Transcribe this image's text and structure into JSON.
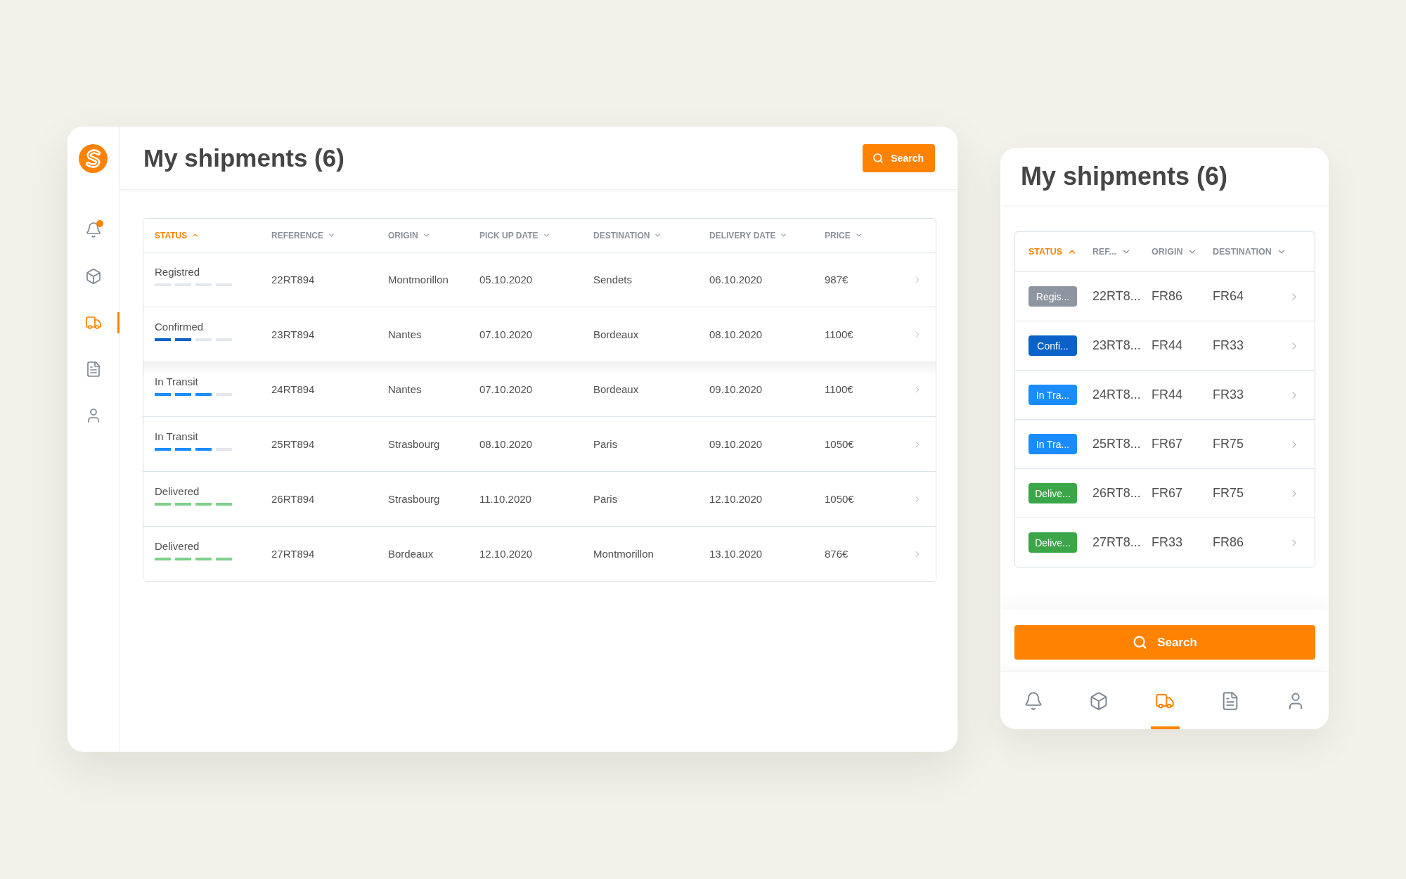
{
  "desktop": {
    "sidebar": {
      "items": [
        {
          "kind": "bell",
          "selected": false,
          "dot": true
        },
        {
          "kind": "box",
          "selected": false,
          "dot": false
        },
        {
          "kind": "truck",
          "selected": true,
          "dot": false
        },
        {
          "kind": "document",
          "selected": false,
          "dot": false
        },
        {
          "kind": "user",
          "selected": false,
          "dot": false
        }
      ]
    },
    "title": "My shipments (6)",
    "search_button": "Search",
    "table": {
      "columns": [
        {
          "label": "STATUS",
          "sorted": true
        },
        {
          "label": "REFERENCE",
          "sorted": false
        },
        {
          "label": "ORIGIN",
          "sorted": false
        },
        {
          "label": "PICK UP DATE",
          "sorted": false
        },
        {
          "label": "DESTINATION",
          "sorted": false
        },
        {
          "label": "DELIVERY DATE",
          "sorted": false
        },
        {
          "label": "PRICE",
          "sorted": false
        }
      ],
      "rows": [
        {
          "status": "Registred",
          "level": 0,
          "reference": "22RT894",
          "origin": "Montmorillon",
          "pick_up_date": "05.10.2020",
          "destination": "Sendets",
          "delivery_date": "06.10.2020",
          "price": "987€",
          "hovered": false
        },
        {
          "status": "Confirmed",
          "level": 0.5,
          "color": "#0a62c9",
          "reference": "23RT894",
          "origin": "Nantes",
          "pick_up_date": "07.10.2020",
          "destination": "Bordeaux",
          "delivery_date": "08.10.2020",
          "price": "1100€",
          "hovered": true
        },
        {
          "status": "In Transit",
          "level": 0.75,
          "color": "#1a8cff",
          "reference": "24RT894",
          "origin": "Nantes",
          "pick_up_date": "07.10.2020",
          "destination": "Bordeaux",
          "delivery_date": "09.10.2020",
          "price": "1100€",
          "hovered": false
        },
        {
          "status": "In Transit",
          "level": 0.75,
          "color": "#1a8cff",
          "reference": "25RT894",
          "origin": "Strasbourg",
          "pick_up_date": "08.10.2020",
          "destination": "Paris",
          "delivery_date": "09.10.2020",
          "price": "1050€",
          "hovered": false
        },
        {
          "status": "Delivered",
          "level": 1,
          "color": "#7dd08a",
          "reference": "26RT894",
          "origin": "Strasbourg",
          "pick_up_date": "11.10.2020",
          "destination": "Paris",
          "delivery_date": "12.10.2020",
          "price": "1050€",
          "hovered": false
        },
        {
          "status": "Delivered",
          "level": 1,
          "color": "#7dd08a",
          "reference": "27RT894",
          "origin": "Bordeaux",
          "pick_up_date": "12.10.2020",
          "destination": "Montmorillon",
          "delivery_date": "13.10.2020",
          "price": "876€",
          "hovered": false
        }
      ]
    }
  },
  "mobile": {
    "title": "My shipments (6)",
    "table": {
      "columns": [
        {
          "label": "STATUS",
          "sorted": true
        },
        {
          "label": "REF...",
          "sorted": false
        },
        {
          "label": "ORIGIN",
          "sorted": false
        },
        {
          "label": "DESTINATION",
          "sorted": false
        }
      ],
      "rows": [
        {
          "status": "Regis...",
          "color": "#8d96a0",
          "reference": "22RT8...",
          "origin": "FR86",
          "destination": "FR64"
        },
        {
          "status": "Confi...",
          "color": "#0a62c9",
          "reference": "23RT8...",
          "origin": "FR44",
          "destination": "FR33"
        },
        {
          "status": "In Tra...",
          "color": "#1a8cff",
          "reference": "24RT8...",
          "origin": "FR44",
          "destination": "FR33"
        },
        {
          "status": "In Tra...",
          "color": "#1a8cff",
          "reference": "25RT8...",
          "origin": "FR67",
          "destination": "FR75"
        },
        {
          "status": "Delive...",
          "color": "#3aa648",
          "reference": "26RT8...",
          "origin": "FR67",
          "destination": "FR75"
        },
        {
          "status": "Delive...",
          "color": "#3aa648",
          "reference": "27RT8...",
          "origin": "FR33",
          "destination": "FR86"
        }
      ]
    },
    "search_button": "Search",
    "nav": {
      "items": [
        {
          "kind": "bell",
          "selected": false
        },
        {
          "kind": "box",
          "selected": false
        },
        {
          "kind": "truck",
          "selected": true
        },
        {
          "kind": "document",
          "selected": false
        },
        {
          "kind": "user",
          "selected": false
        }
      ]
    }
  }
}
